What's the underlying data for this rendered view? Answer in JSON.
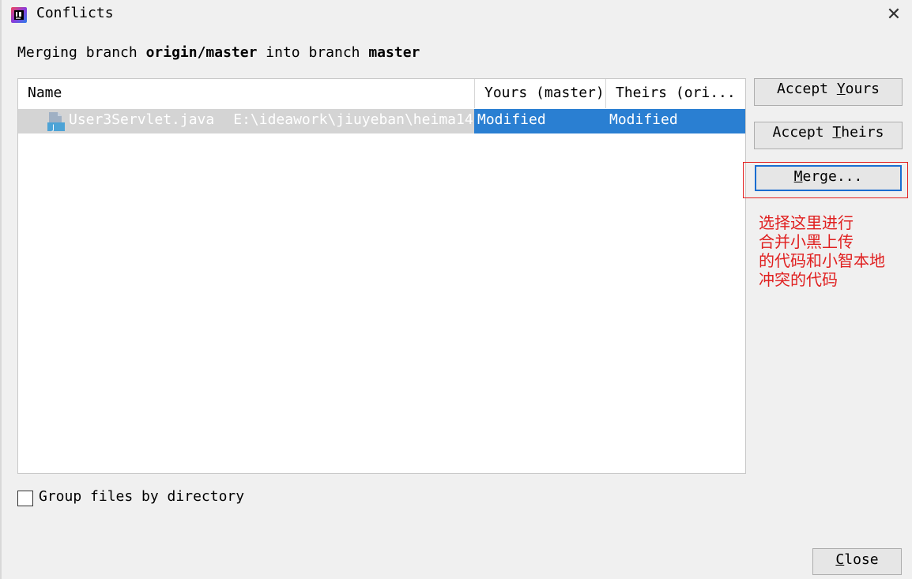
{
  "window": {
    "title": "Conflicts",
    "close_glyph": "✕",
    "app_icon": "intellij-idea-icon"
  },
  "heading": {
    "prefix": "Merging branch ",
    "source_branch": "origin/master",
    "middle": " into branch ",
    "target_branch": "master"
  },
  "table": {
    "columns": [
      "Name",
      "Yours (master)",
      "Theirs (ori..."
    ],
    "rows": [
      {
        "file_icon": "java-file-icon",
        "file": "User3Servlet.java",
        "path": "E:\\ideawork\\jiuyeban\\heima14",
        "yours": "Modified",
        "theirs": "Modified"
      }
    ]
  },
  "buttons": {
    "accept_yours": {
      "pre": "Accept ",
      "mnemonic": "Y",
      "post": "ours"
    },
    "accept_theirs": {
      "pre": "Accept ",
      "mnemonic": "T",
      "post": "heirs"
    },
    "merge": {
      "pre": "",
      "mnemonic": "M",
      "post": "erge..."
    },
    "close": {
      "pre": "",
      "mnemonic": "C",
      "post": "lose"
    }
  },
  "annotation": {
    "text": "选择这里进行\n合并小黑上传\n的代码和小智本地\n冲突的代码",
    "color": "#e02020"
  },
  "options": {
    "group_by_directory_label": "Group files by directory",
    "group_by_directory_checked": false
  },
  "colors": {
    "selection_blue": "#2a7fd2",
    "annotation_red": "#e02020",
    "focus_border": "#1a6dd0"
  }
}
